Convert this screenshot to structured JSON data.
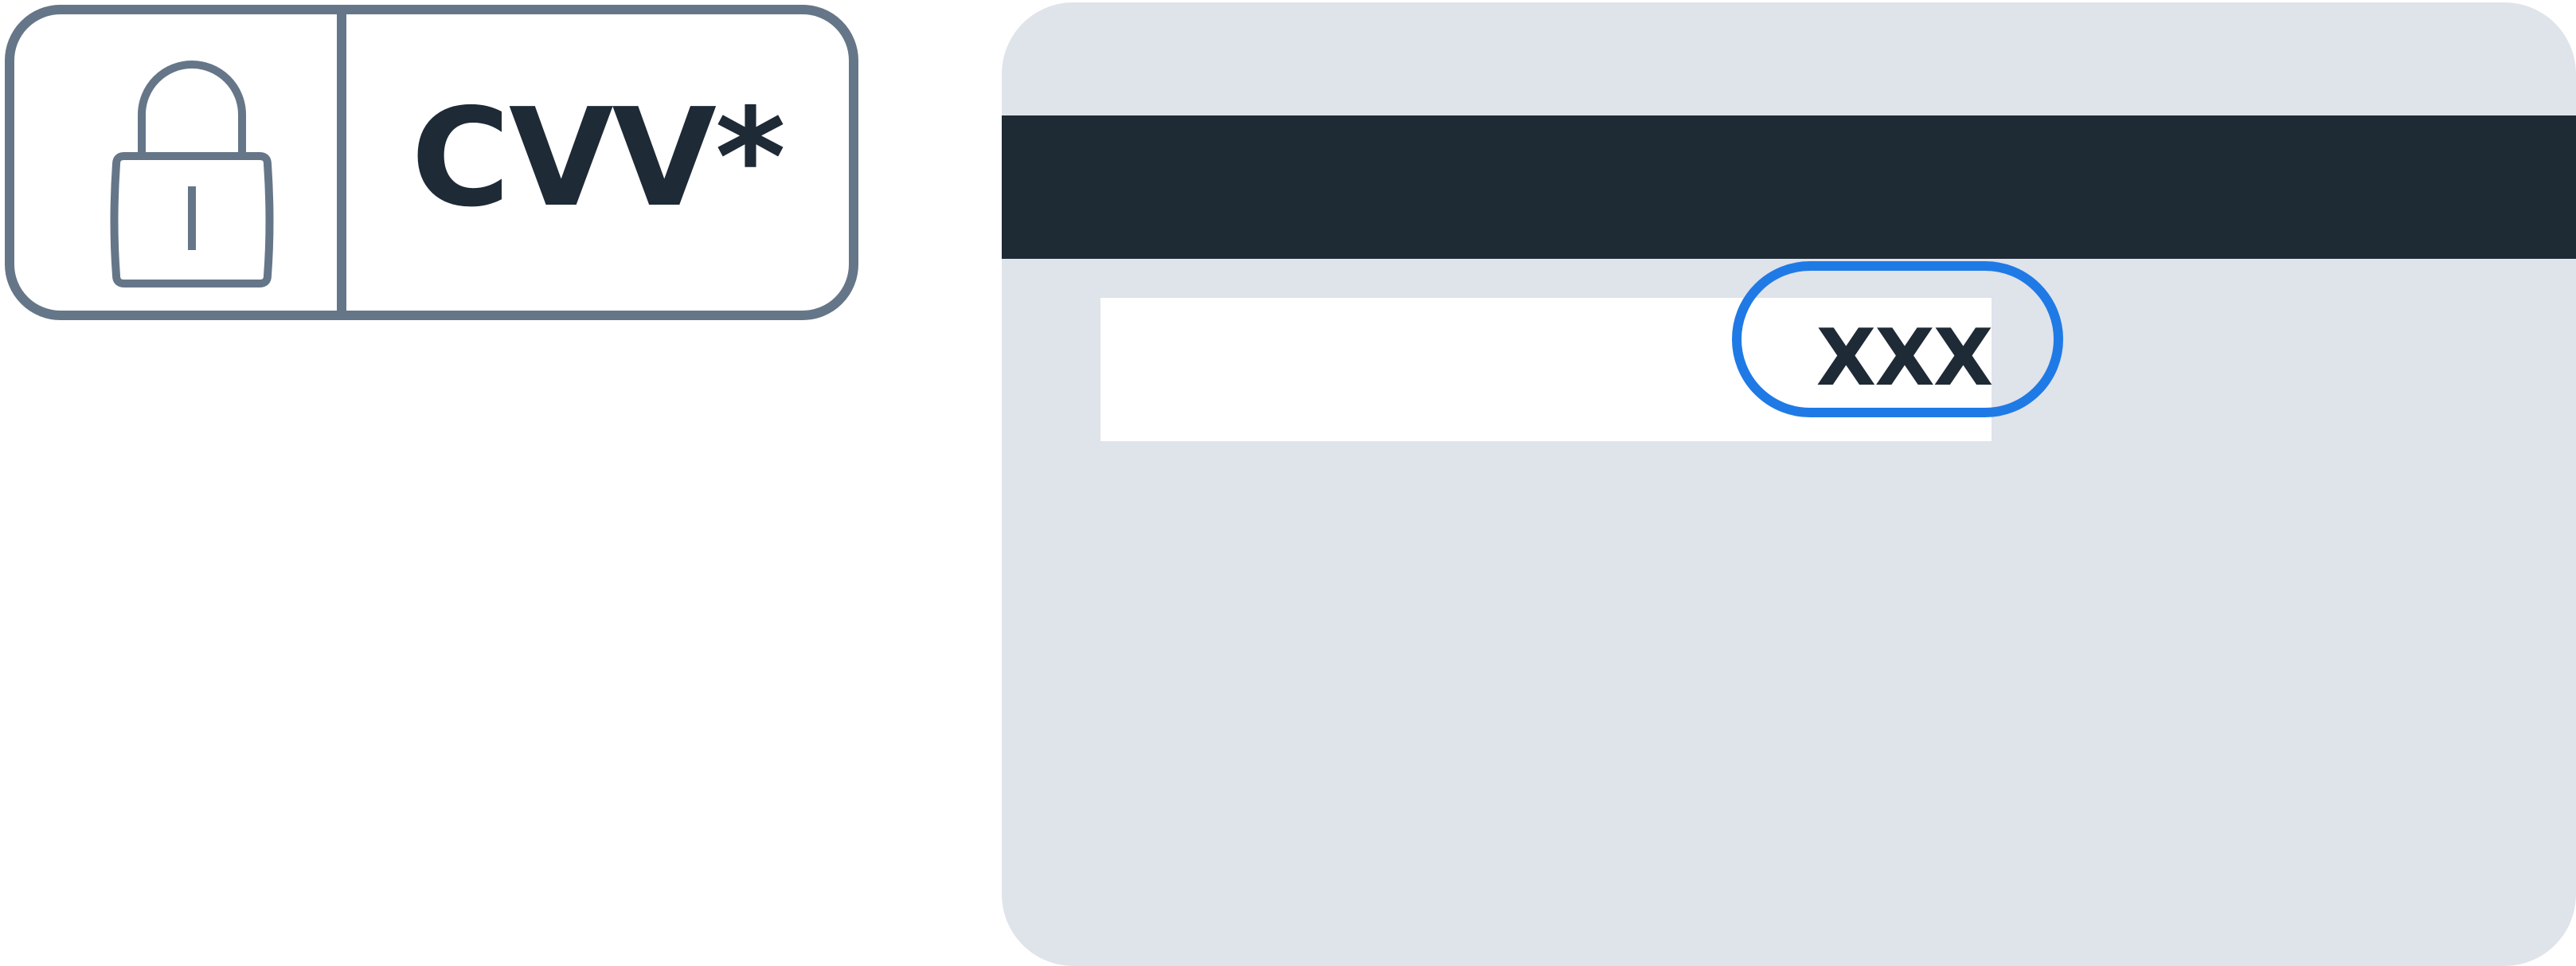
{
  "cvv_field": {
    "lock_icon": "lock-icon",
    "label": "CVV*"
  },
  "card_back": {
    "cvv_code": "XXX"
  },
  "colors": {
    "field_border": "#667689",
    "text": "#1e2a36",
    "card_background": "#dfe3ea",
    "magnetic_stripe": "#1e2b35",
    "highlight": "#1f7ae6"
  }
}
